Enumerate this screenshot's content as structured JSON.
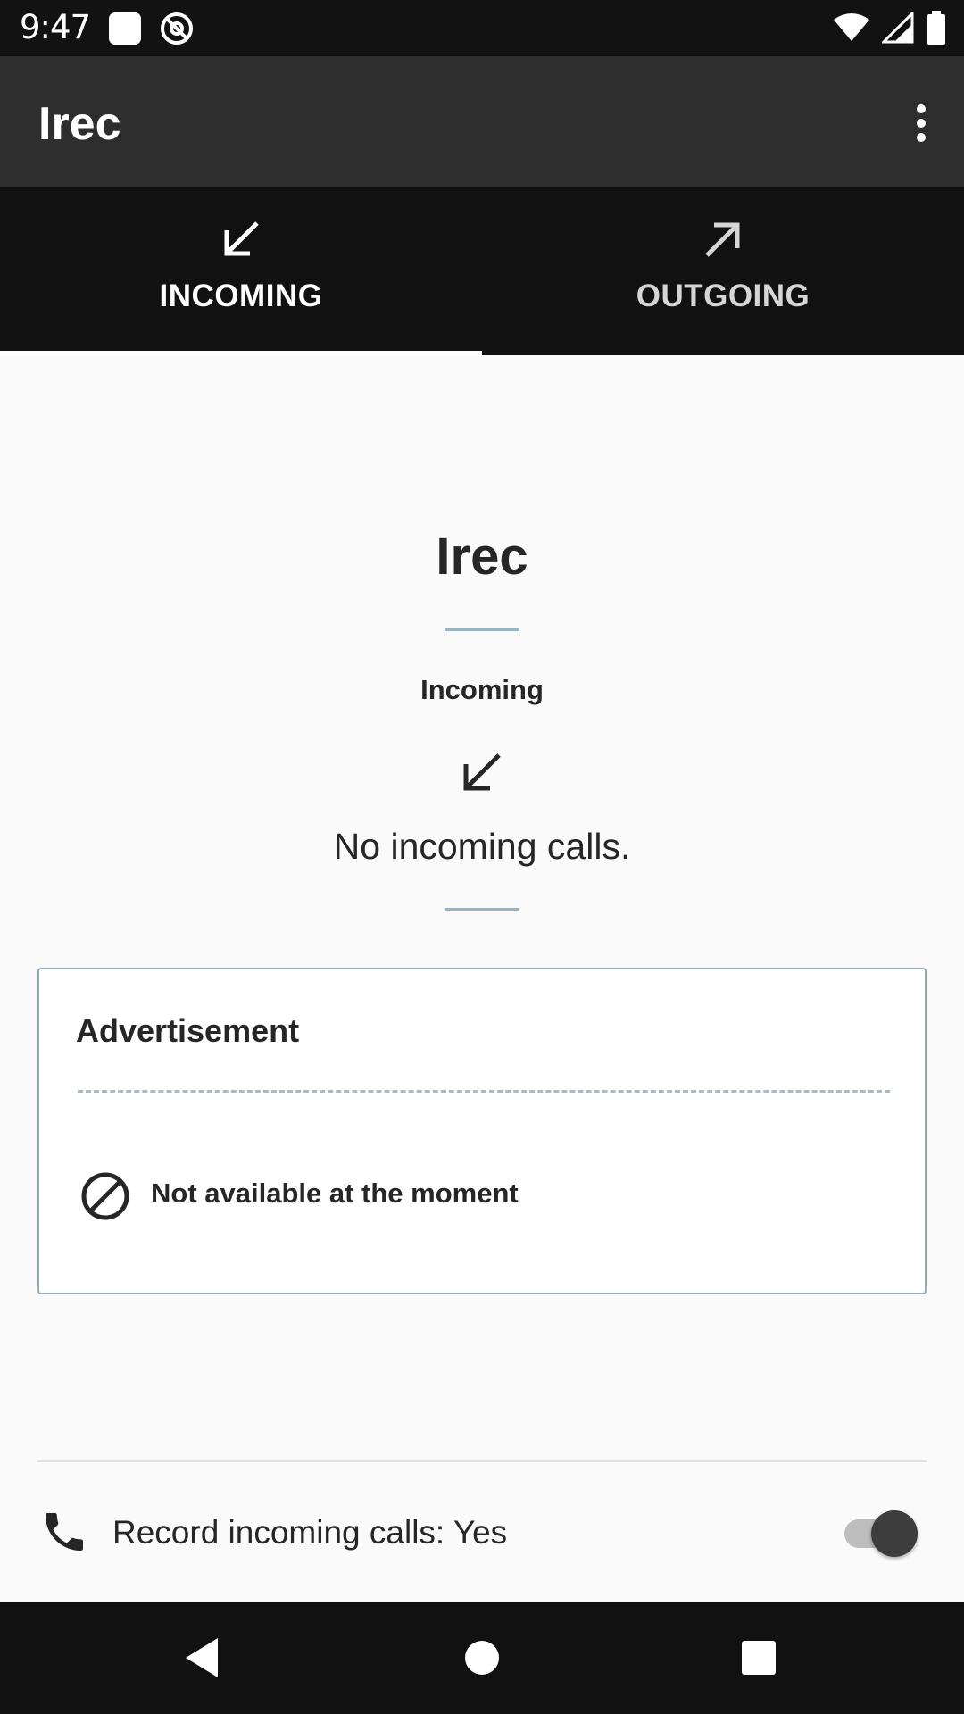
{
  "status_bar": {
    "time": "9:47",
    "left_icons": [
      "notification-square-icon",
      "vpn-at-icon"
    ],
    "right_icons": [
      "wifi-icon",
      "cell-signal-icon",
      "battery-icon"
    ]
  },
  "app_bar": {
    "title": "Irec",
    "overflow_icon": "more-vert-icon"
  },
  "tabs": [
    {
      "label": "INCOMING",
      "icon": "arrow-down-left-icon",
      "selected": true
    },
    {
      "label": "OUTGOING",
      "icon": "arrow-up-right-icon",
      "selected": false
    }
  ],
  "main": {
    "title": "Irec",
    "section_label": "Incoming",
    "section_icon": "arrow-down-left-icon",
    "empty_message": "No incoming calls."
  },
  "ad_card": {
    "title": "Advertisement",
    "status_icon": "block-icon",
    "status_text": "Not available at the moment"
  },
  "record_row": {
    "icon": "phone-icon",
    "label": "Record incoming calls: Yes",
    "toggle_on": true
  },
  "nav_bar": {
    "buttons": [
      "back-icon",
      "home-icon",
      "recents-icon"
    ]
  },
  "colors": {
    "app_bar": "#2e2e2e",
    "tab_bar": "#111111",
    "background": "#fafafa",
    "divider_accent": "#9ab3c0",
    "card_border": "#93abb7"
  }
}
